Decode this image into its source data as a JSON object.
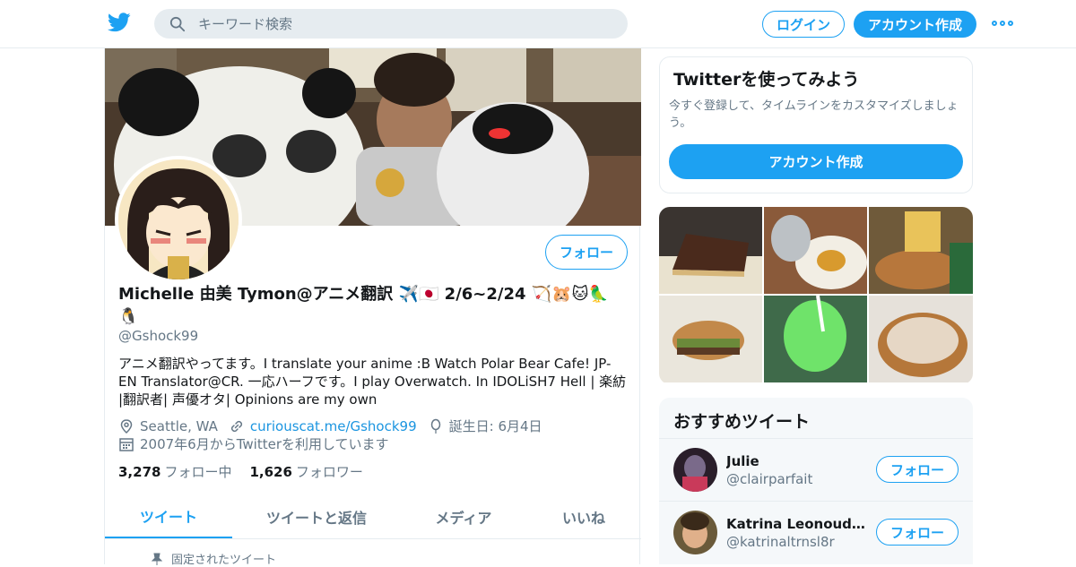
{
  "header": {
    "search_placeholder": "キーワード検索",
    "login_label": "ログイン",
    "signup_label": "アカウント作成"
  },
  "profile": {
    "display_name": "Michelle 由美 Tymon@アニメ翻訳 ✈️🇯🇵 2/6~2/24 🏹🐹🐱🦜🐧",
    "handle": "@Gshock99",
    "bio": "アニメ翻訳やってます。I translate your anime :B Watch Polar Bear Cafe! JP-EN Translator@CR. 一応ハーフです。I play Overwatch. In IDOLiSH7 Hell | 楽紡 |翻訳者| 声優オタ| Opinions are my own",
    "location": "Seattle, WA",
    "website": "curiouscat.me/Gshock99",
    "birthday": "誕生日: 6月4日",
    "joined": "2007年6月からTwitterを利用しています",
    "following_count": "3,278",
    "following_label": "フォロー中",
    "followers_count": "1,626",
    "followers_label": "フォロワー",
    "follow_label": "フォロー",
    "tabs": [
      {
        "label": "ツイート"
      },
      {
        "label": "ツイートと返信"
      },
      {
        "label": "メディア"
      },
      {
        "label": "いいね"
      }
    ],
    "pinned_label": "固定されたツイート"
  },
  "signup_card": {
    "title": "Twitterを使ってみよう",
    "text": "今すぐ登録して、タイムラインをカスタマイズしましょう。",
    "button": "アカウント作成"
  },
  "recommended": {
    "title": "おすすめツイート",
    "items": [
      {
        "name": "Julie",
        "handle": "@clairparfait",
        "follow": "フォロー"
      },
      {
        "name": "Katrina Leonoudakis",
        "handle": "@katrinaltrnsl8r",
        "follow": "フォロー"
      }
    ]
  },
  "colors": {
    "accent": "#1da1f2",
    "link": "#1b95e0",
    "muted": "#657786"
  }
}
